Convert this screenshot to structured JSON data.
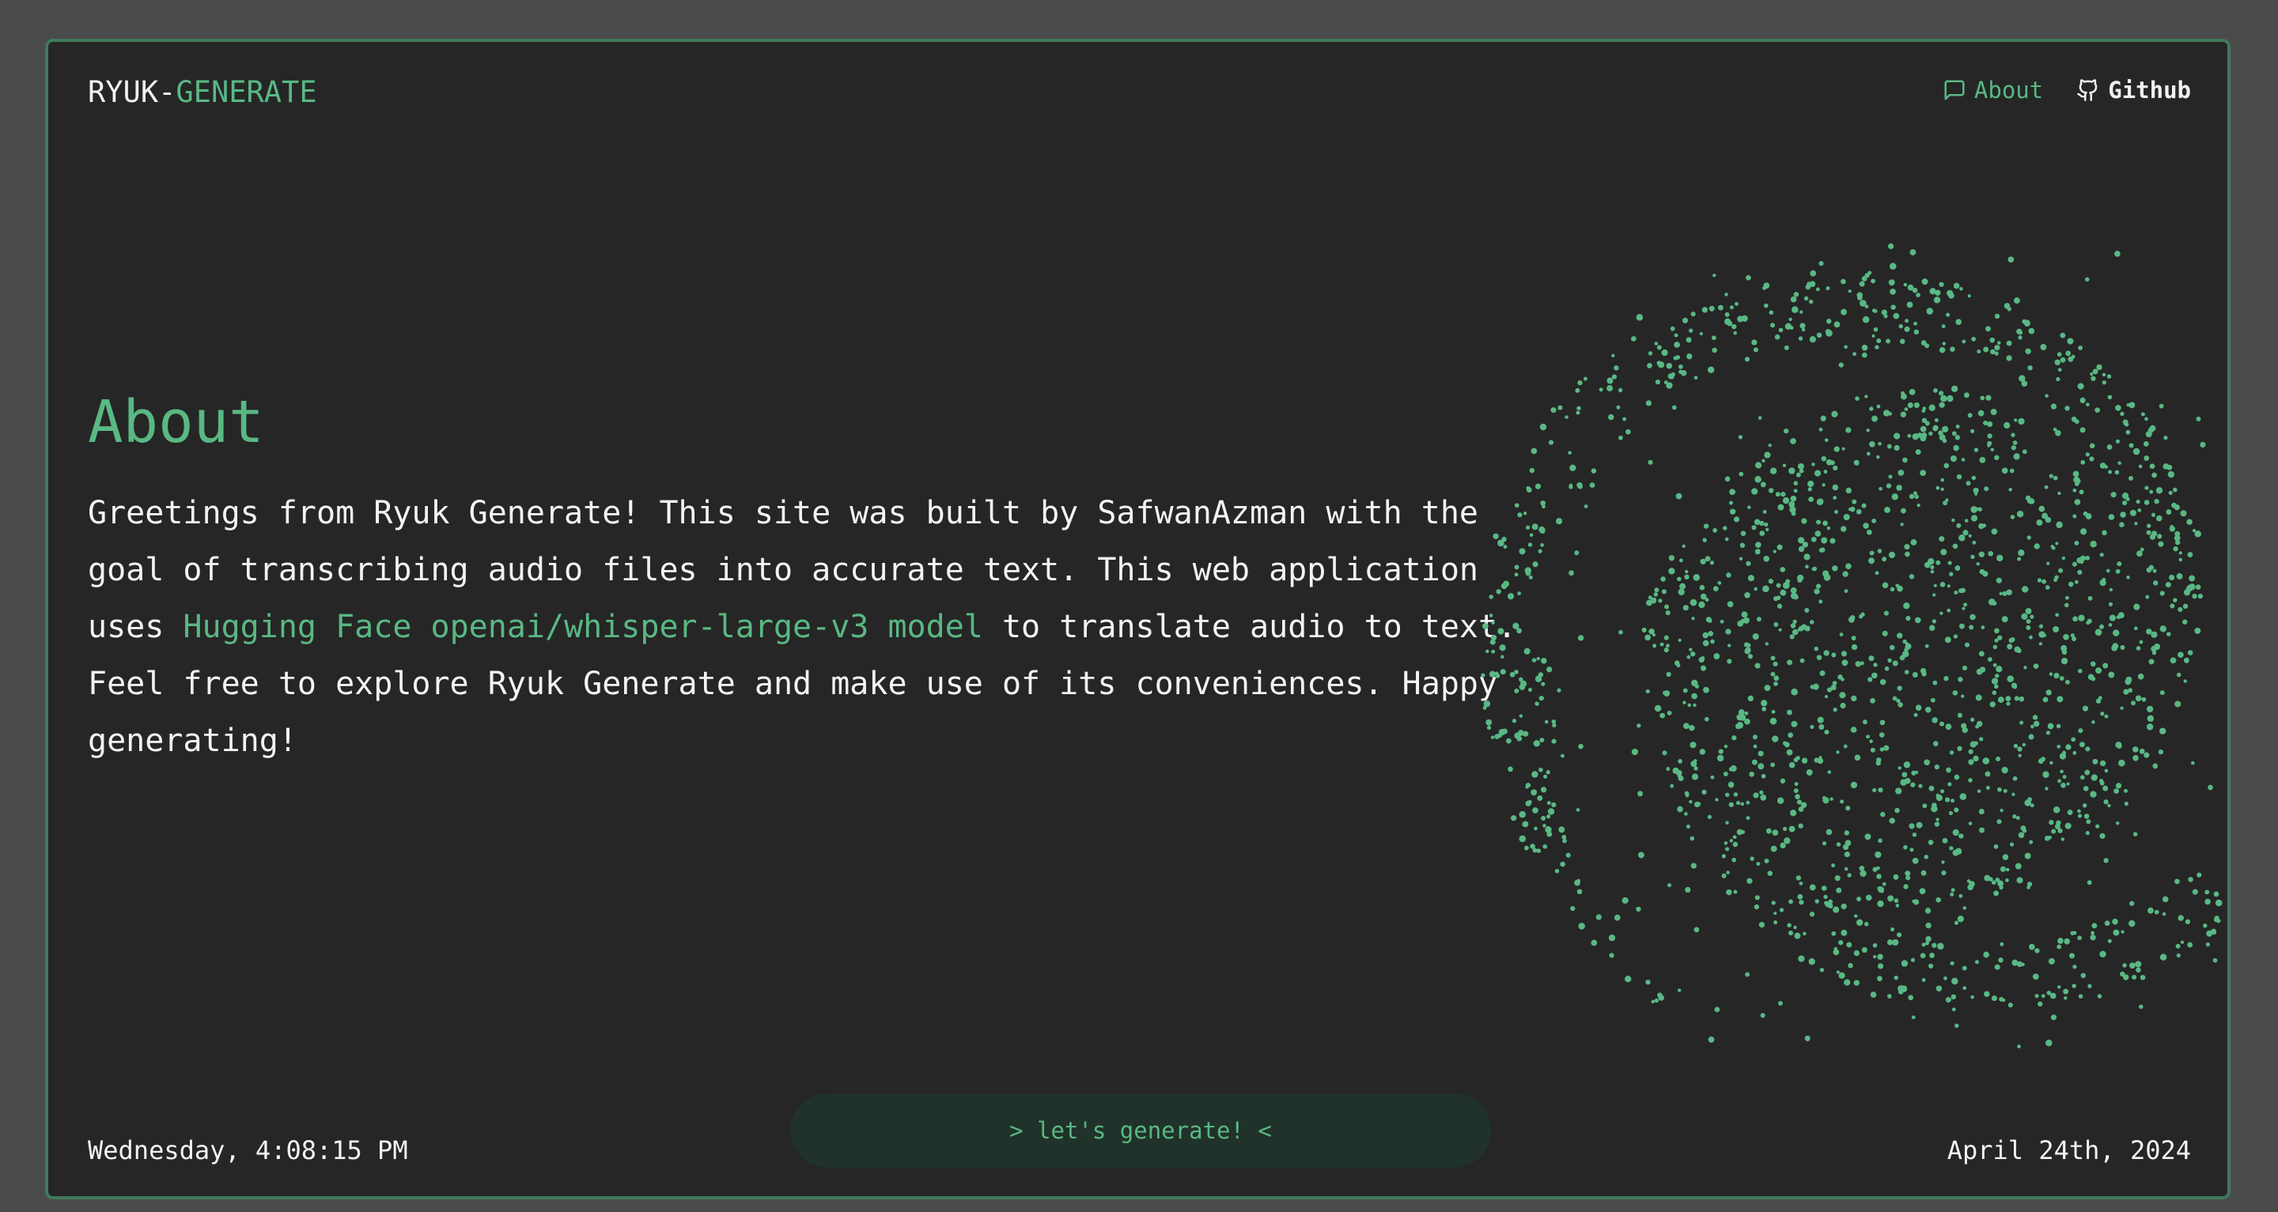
{
  "brand": {
    "prefix": "RYUK-",
    "accent": "GENERATE"
  },
  "nav": {
    "about": {
      "label": "About",
      "icon": "message-square-icon"
    },
    "github": {
      "label": "Github",
      "icon": "github-icon"
    }
  },
  "main": {
    "heading": "About",
    "paragraph": {
      "before_link": "Greetings from Ryuk Generate! This site was built by SafwanAzman with the goal of transcribing audio files into accurate text. This web application uses ",
      "link": "Hugging Face openai/whisper-large-v3 model",
      "after_link": " to translate audio to text. Feel free to explore Ryuk Generate and make use of its conveniences. Happy generating!"
    }
  },
  "footer": {
    "time": "Wednesday, 4:08:15 PM",
    "button": "> let's generate! <",
    "date": "April 24th, 2024"
  },
  "colors": {
    "accent": "#59b884",
    "background": "#262626",
    "outer": "#4b4b4b",
    "button_bg": "#20322a",
    "text": "#f3f3f3"
  }
}
